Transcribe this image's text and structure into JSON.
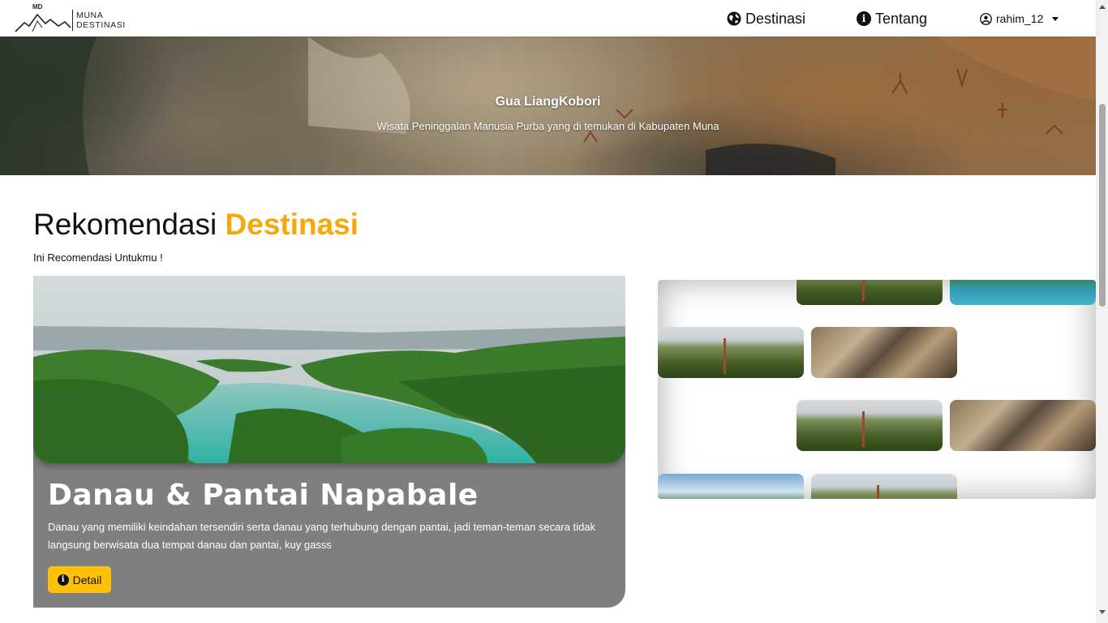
{
  "brand": {
    "badge": "MD",
    "line1": "MUNA",
    "line2": "DESTINASI"
  },
  "nav": {
    "destinations": {
      "label": "Destinasi",
      "icon": "globe-icon"
    },
    "about": {
      "label": "Tentang",
      "icon": "info-icon"
    },
    "user": {
      "label": "rahim_12",
      "icon": "user-circle-icon"
    }
  },
  "hero": {
    "title": "Gua LiangKobori",
    "subtitle": "Wisata Peninggalan Manusia Purba yang di temukan di Kabupaten Muna"
  },
  "section": {
    "title_main": "Rekomendasi",
    "title_accent": "Destinasi",
    "subtitle": "Ini Recomendasi Untukmu !",
    "accent_color": "#f7a707"
  },
  "featured": {
    "title": "Danau & Pantai Napabale",
    "description": "Danau yang memiliki keindahan tersendiri serta danau yang terhubung dengan pantai, jadi teman-teman secara tidak langsung berwisata dua tempat danau dan pantai, kuy gasss",
    "button_label": "Detail",
    "button_color": "#ffc107"
  }
}
